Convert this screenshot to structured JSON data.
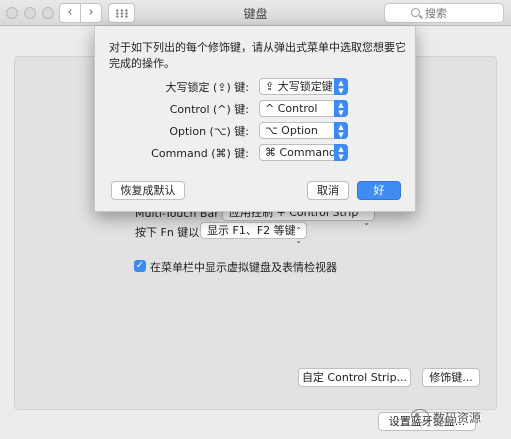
{
  "window": {
    "title": "键盘",
    "search_placeholder": "搜索"
  },
  "background": {
    "touchbar_label": "Multi-Touch Bar 显示",
    "touchbar_value": "应用控制 + Control Strip",
    "fn_label": "按下 Fn 键以",
    "fn_value": "显示 F1、F2 等键",
    "show_viewer_checkbox": "在菜单栏中显示虚拟键盘及表情检视器",
    "show_viewer_checked": true,
    "customize_control_strip": "自定 Control Strip...",
    "modifier_keys": "修饰键...",
    "setup_bluetooth": "设置蓝牙键盘..."
  },
  "sheet": {
    "instruction": "对于如下列出的每个修饰键，请从弹出式菜单中选取您想要它完成的操作。",
    "rows": [
      {
        "label": "大写锁定 (⇪) 键:",
        "value": "⇪ 大写锁定键"
      },
      {
        "label": "Control (^) 键:",
        "value": "^ Control"
      },
      {
        "label": "Option (⌥) 键:",
        "value": "⌥ Option"
      },
      {
        "label": "Command (⌘) 键:",
        "value": "⌘ Command"
      }
    ],
    "restore_defaults": "恢复成默认",
    "cancel": "取消",
    "ok": "好"
  },
  "watermark": {
    "text": "数码资源"
  },
  "colors": {
    "accent": "#3b8af5",
    "window_bg": "#ececec"
  }
}
